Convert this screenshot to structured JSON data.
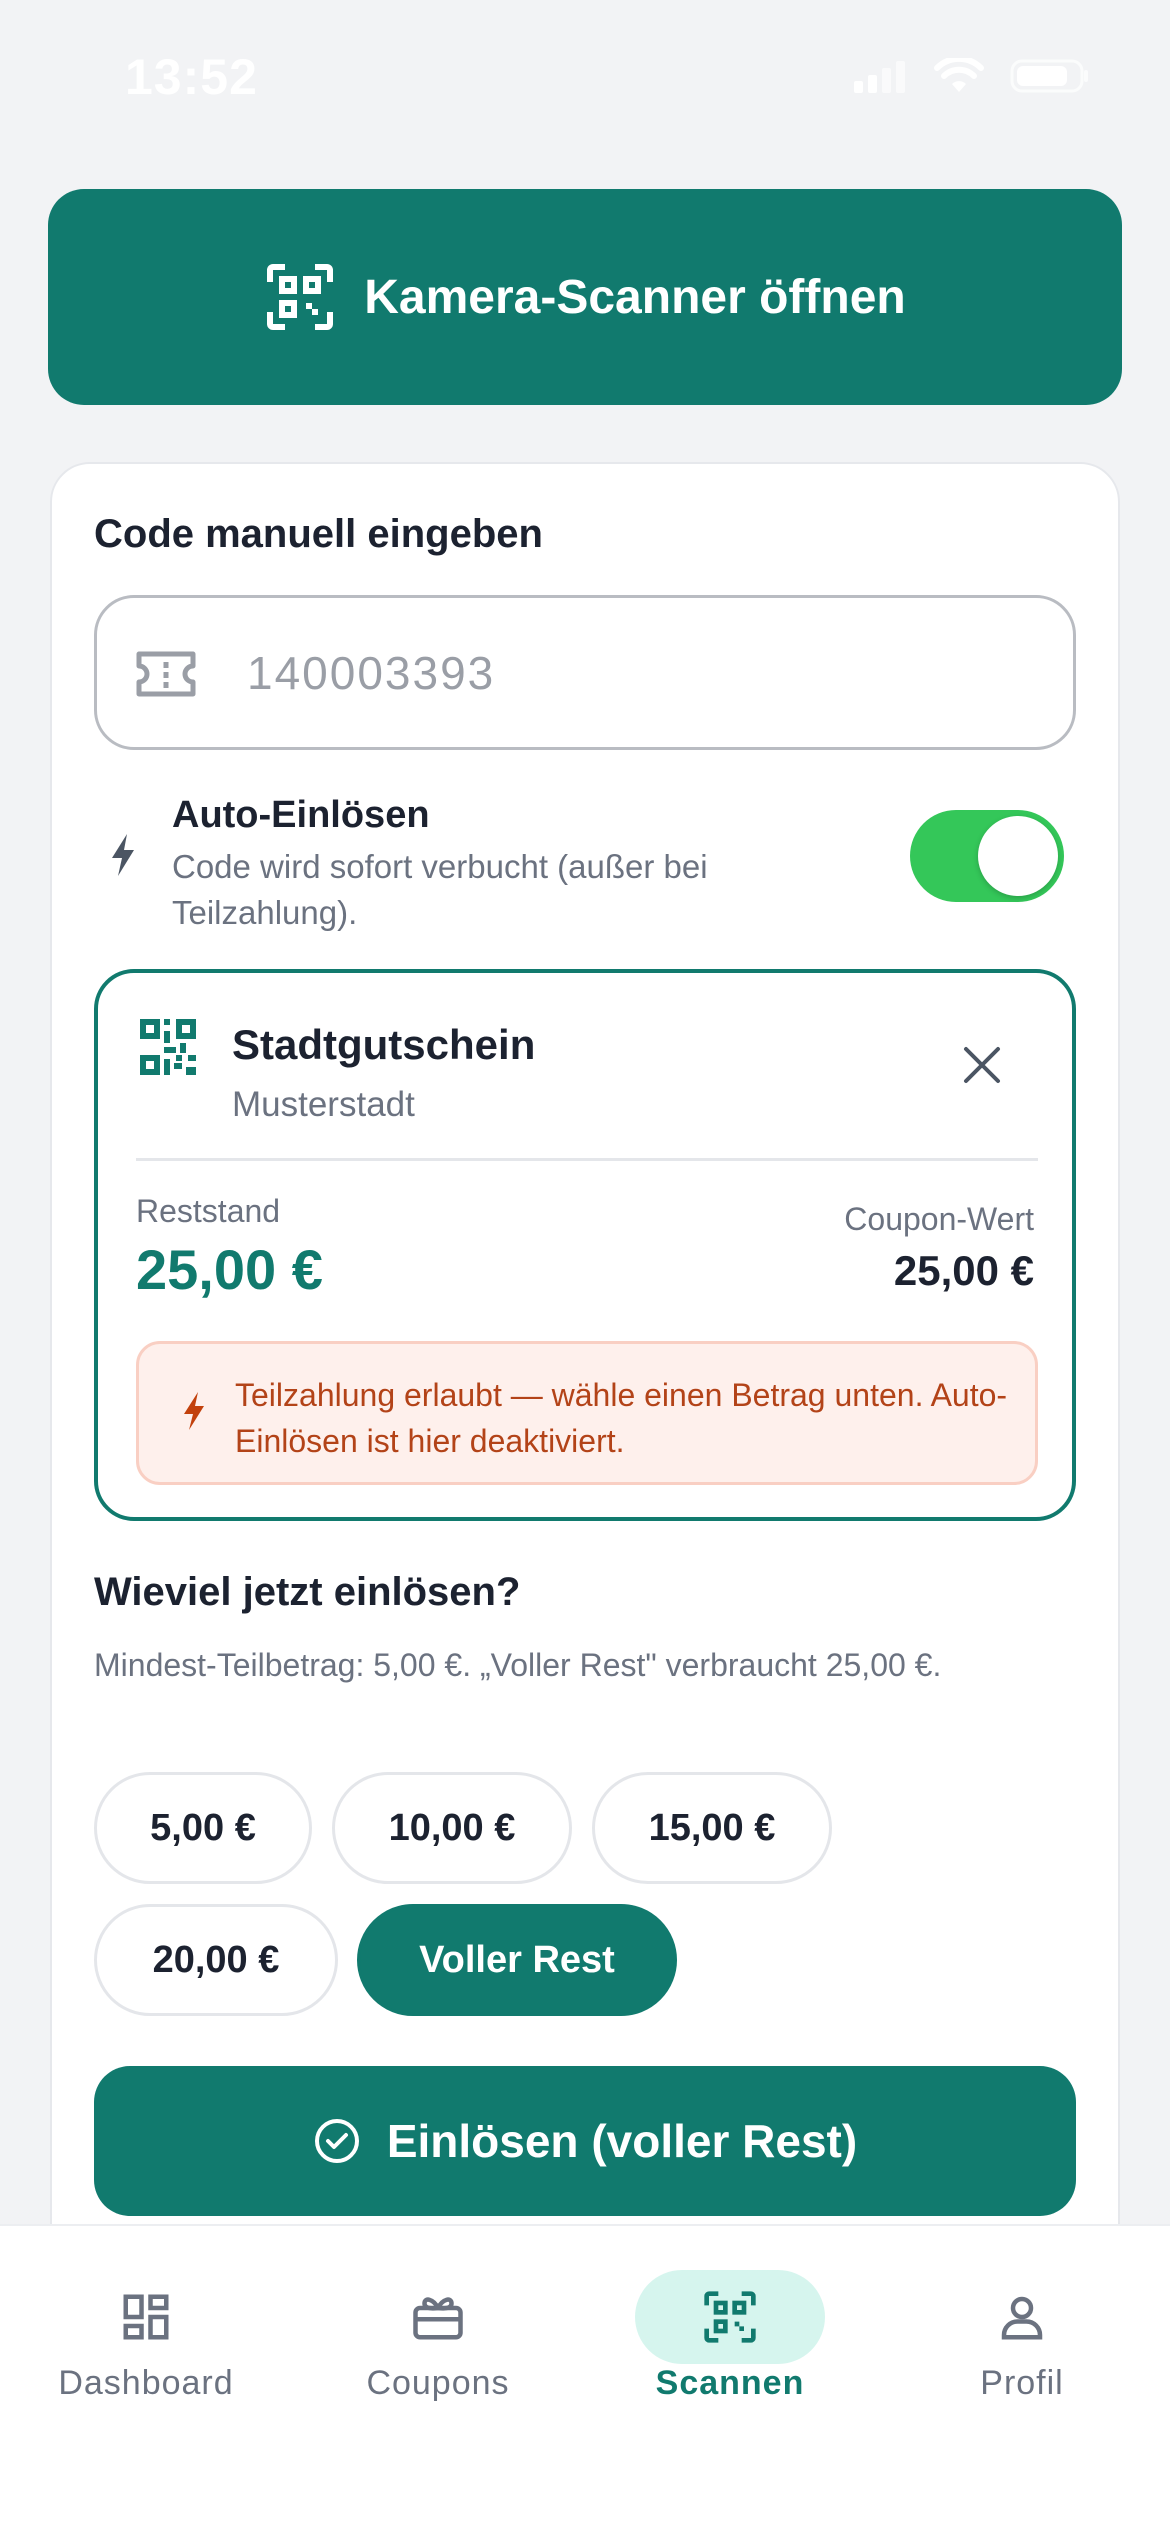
{
  "status_bar": {
    "time": "13:52"
  },
  "scan_button": {
    "label": "Kamera-Scanner öffnen"
  },
  "manual": {
    "title": "Code manuell eingeben",
    "placeholder": "140003393"
  },
  "auto_redeem": {
    "title": "Auto-Einlösen",
    "description": "Code wird sofort verbucht (außer bei Teilzahlung).",
    "enabled": true
  },
  "coupon": {
    "name": "Stadtgutschein",
    "city": "Musterstadt",
    "rest_label": "Reststand",
    "rest_value": "25,00 €",
    "value_label": "Coupon-Wert",
    "value": "25,00 €",
    "warning": "Teilzahlung erlaubt — wähle einen Betrag unten. Auto-Einlösen ist hier deaktiviert."
  },
  "amount": {
    "title": "Wieviel jetzt einlösen?",
    "hint": "Mindest-Teilbetrag: 5,00 €. „Voller Rest\" verbraucht 25,00 €.",
    "chips": [
      "5,00 €",
      "10,00 €",
      "15,00 €",
      "20,00 €",
      "Voller Rest"
    ],
    "selected": "Voller Rest"
  },
  "redeem_button": {
    "label": "Einlösen (voller Rest)"
  },
  "tabs": [
    {
      "label": "Dashboard",
      "icon": "dashboard-icon"
    },
    {
      "label": "Coupons",
      "icon": "gift-icon"
    },
    {
      "label": "Scannen",
      "icon": "qr-code-icon",
      "active": true
    },
    {
      "label": "Profil",
      "icon": "person-icon"
    }
  ],
  "colors": {
    "brand": "#117a6e",
    "toggle_on": "#34c759",
    "warning_text": "#b34318",
    "warning_bg": "#fef0ec"
  }
}
